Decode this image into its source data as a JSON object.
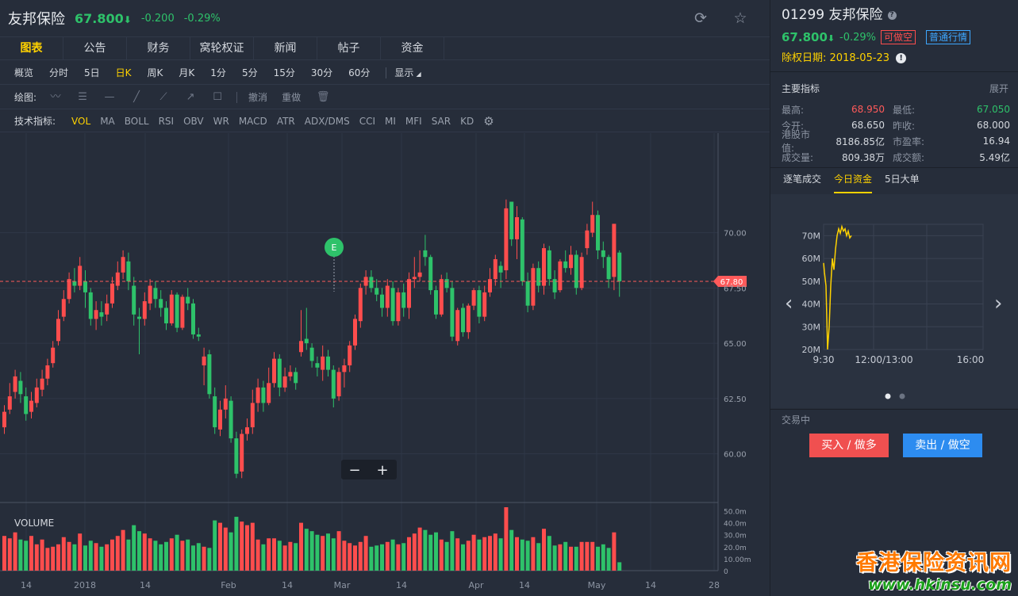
{
  "header": {
    "name": "友邦保险",
    "price": "67.800",
    "arrow": "⬇",
    "change": "-0.200",
    "change_pct": "-0.29%"
  },
  "tabs": [
    "图表",
    "公告",
    "财务",
    "窝轮权证",
    "新闻",
    "帖子",
    "资金"
  ],
  "periods": [
    "概览",
    "分时",
    "5日",
    "日K",
    "周K",
    "月K",
    "1分",
    "5分",
    "15分",
    "30分",
    "60分"
  ],
  "display_label": "显示",
  "draw_label": "绘图:",
  "draw_undo": "撤消",
  "draw_redo": "重做",
  "ind_label": "技术指标:",
  "indicators": [
    "VOL",
    "MA",
    "BOLL",
    "RSI",
    "OBV",
    "WR",
    "MACD",
    "ATR",
    "ADX/DMS",
    "CCI",
    "MI",
    "MFI",
    "SAR",
    "KD"
  ],
  "chart": {
    "current_price_tag": "67.80",
    "event_marker": "E",
    "volume_label": "VOLUME",
    "zoom_minus": "−",
    "zoom_plus": "+"
  },
  "chart_data": {
    "type": "candlestick",
    "price_axis_ticks": [
      "70.00",
      "67.50",
      "65.00",
      "62.50",
      "60.00"
    ],
    "price_axis_values": [
      70.0,
      67.5,
      65.0,
      62.5,
      60.0
    ],
    "ylim": [
      57.8,
      74.5
    ],
    "volume_axis_ticks": [
      "50.0m",
      "40.0m",
      "30.0m",
      "20.0m",
      "10.00m",
      "0"
    ],
    "volume_axis_values": [
      50,
      40,
      30,
      20,
      10,
      0
    ],
    "vol_max": 53,
    "x_labels": [
      "14",
      "2018",
      "14",
      "Feb",
      "14",
      "Mar",
      "14",
      "Apr",
      "14",
      "May",
      "14",
      "28"
    ],
    "current_price": 67.8,
    "candles": [
      {
        "o": 61.2,
        "c": 61.9,
        "h": 62.2,
        "l": 60.9,
        "v": 29
      },
      {
        "o": 62.0,
        "c": 62.6,
        "h": 63.2,
        "l": 61.8,
        "v": 27
      },
      {
        "o": 62.8,
        "c": 63.5,
        "h": 63.8,
        "l": 62.5,
        "v": 32
      },
      {
        "o": 63.3,
        "c": 62.7,
        "h": 63.7,
        "l": 62.3,
        "v": 26
      },
      {
        "o": 62.6,
        "c": 61.8,
        "h": 63.0,
        "l": 61.5,
        "v": 25
      },
      {
        "o": 61.9,
        "c": 62.4,
        "h": 62.8,
        "l": 61.6,
        "v": 29
      },
      {
        "o": 62.3,
        "c": 63.0,
        "h": 63.4,
        "l": 62.1,
        "v": 22
      },
      {
        "o": 62.9,
        "c": 63.4,
        "h": 63.8,
        "l": 62.6,
        "v": 26
      },
      {
        "o": 63.4,
        "c": 64.0,
        "h": 64.3,
        "l": 63.1,
        "v": 19
      },
      {
        "o": 64.1,
        "c": 64.8,
        "h": 65.1,
        "l": 63.9,
        "v": 20
      },
      {
        "o": 65.1,
        "c": 66.1,
        "h": 66.5,
        "l": 64.9,
        "v": 22
      },
      {
        "o": 66.2,
        "c": 67.0,
        "h": 67.4,
        "l": 66.0,
        "v": 28
      },
      {
        "o": 67.0,
        "c": 67.9,
        "h": 68.2,
        "l": 66.8,
        "v": 24
      },
      {
        "o": 67.8,
        "c": 67.6,
        "h": 68.4,
        "l": 67.3,
        "v": 22
      },
      {
        "o": 67.6,
        "c": 68.5,
        "h": 68.9,
        "l": 67.4,
        "v": 31
      },
      {
        "o": 67.8,
        "c": 67.3,
        "h": 68.3,
        "l": 66.6,
        "v": 21
      },
      {
        "o": 67.3,
        "c": 66.1,
        "h": 67.5,
        "l": 65.8,
        "v": 25
      },
      {
        "o": 66.1,
        "c": 66.5,
        "h": 66.9,
        "l": 65.6,
        "v": 23
      },
      {
        "o": 66.4,
        "c": 66.2,
        "h": 66.9,
        "l": 65.8,
        "v": 20
      },
      {
        "o": 66.3,
        "c": 66.8,
        "h": 67.2,
        "l": 66.0,
        "v": 22
      },
      {
        "o": 66.8,
        "c": 67.7,
        "h": 68.0,
        "l": 66.6,
        "v": 26
      },
      {
        "o": 67.6,
        "c": 68.2,
        "h": 68.7,
        "l": 67.4,
        "v": 29
      },
      {
        "o": 68.2,
        "c": 68.9,
        "h": 69.2,
        "l": 67.9,
        "v": 34
      },
      {
        "o": 68.7,
        "c": 67.8,
        "h": 69.1,
        "l": 67.4,
        "v": 26
      },
      {
        "o": 67.6,
        "c": 66.3,
        "h": 68.0,
        "l": 65.8,
        "v": 38
      },
      {
        "o": 66.2,
        "c": 66.1,
        "h": 66.6,
        "l": 64.5,
        "v": 33
      },
      {
        "o": 66.1,
        "c": 66.9,
        "h": 67.3,
        "l": 65.8,
        "v": 31
      },
      {
        "o": 66.8,
        "c": 67.6,
        "h": 67.9,
        "l": 66.5,
        "v": 27
      },
      {
        "o": 67.5,
        "c": 67.0,
        "h": 67.8,
        "l": 66.6,
        "v": 25
      },
      {
        "o": 67.0,
        "c": 66.6,
        "h": 67.4,
        "l": 66.2,
        "v": 22
      },
      {
        "o": 66.6,
        "c": 65.9,
        "h": 66.9,
        "l": 65.6,
        "v": 24
      },
      {
        "o": 65.9,
        "c": 67.2,
        "h": 67.4,
        "l": 65.8,
        "v": 27
      },
      {
        "o": 67.2,
        "c": 65.7,
        "h": 67.3,
        "l": 65.5,
        "v": 30
      },
      {
        "o": 65.7,
        "c": 67.1,
        "h": 67.2,
        "l": 65.6,
        "v": 25
      },
      {
        "o": 67.1,
        "c": 66.8,
        "h": 67.5,
        "l": 66.5,
        "v": 26
      },
      {
        "o": 66.8,
        "c": 65.4,
        "h": 67.0,
        "l": 65.2,
        "v": 21
      },
      {
        "o": 65.4,
        "c": 65.3,
        "h": 65.7,
        "l": 65.1,
        "v": 23
      },
      {
        "o": 64.0,
        "c": 64.4,
        "h": 64.8,
        "l": 63.1,
        "v": 20
      },
      {
        "o": 64.5,
        "c": 62.7,
        "h": 64.7,
        "l": 62.5,
        "v": 19
      },
      {
        "o": 62.6,
        "c": 61.2,
        "h": 63.0,
        "l": 60.9,
        "v": 42
      },
      {
        "o": 61.1,
        "c": 62.0,
        "h": 62.4,
        "l": 60.8,
        "v": 40
      },
      {
        "o": 62.0,
        "c": 62.5,
        "h": 63.1,
        "l": 61.6,
        "v": 36
      },
      {
        "o": 62.4,
        "c": 60.7,
        "h": 62.6,
        "l": 60.5,
        "v": 32
      },
      {
        "o": 60.7,
        "c": 59.1,
        "h": 61.0,
        "l": 58.9,
        "v": 45
      },
      {
        "o": 59.2,
        "c": 60.9,
        "h": 61.1,
        "l": 58.9,
        "v": 41
      },
      {
        "o": 60.9,
        "c": 61.2,
        "h": 61.6,
        "l": 60.6,
        "v": 38
      },
      {
        "o": 61.2,
        "c": 62.3,
        "h": 62.9,
        "l": 60.9,
        "v": 40
      },
      {
        "o": 62.3,
        "c": 63.0,
        "h": 63.4,
        "l": 61.9,
        "v": 26
      },
      {
        "o": 63.0,
        "c": 62.3,
        "h": 63.3,
        "l": 61.9,
        "v": 22
      },
      {
        "o": 62.3,
        "c": 63.2,
        "h": 63.9,
        "l": 62.2,
        "v": 27
      },
      {
        "o": 63.2,
        "c": 64.3,
        "h": 64.6,
        "l": 63.0,
        "v": 27
      },
      {
        "o": 64.3,
        "c": 63.0,
        "h": 64.5,
        "l": 62.6,
        "v": 25
      },
      {
        "o": 63.0,
        "c": 63.5,
        "h": 63.9,
        "l": 62.8,
        "v": 21
      },
      {
        "o": 63.5,
        "c": 63.7,
        "h": 64.0,
        "l": 63.3,
        "v": 24
      },
      {
        "o": 63.7,
        "c": 63.2,
        "h": 63.9,
        "l": 62.9,
        "v": 23
      },
      {
        "o": 64.6,
        "c": 65.1,
        "h": 66.5,
        "l": 64.4,
        "v": 40
      },
      {
        "o": 65.2,
        "c": 65.0,
        "h": 66.6,
        "l": 64.7,
        "v": 35
      },
      {
        "o": 64.8,
        "c": 64.2,
        "h": 65.0,
        "l": 63.9,
        "v": 33
      },
      {
        "o": 64.1,
        "c": 63.9,
        "h": 64.4,
        "l": 63.5,
        "v": 30
      },
      {
        "o": 63.8,
        "c": 64.4,
        "h": 64.9,
        "l": 63.3,
        "v": 29
      },
      {
        "o": 64.4,
        "c": 63.8,
        "h": 64.7,
        "l": 63.5,
        "v": 31
      },
      {
        "o": 63.8,
        "c": 62.5,
        "h": 64.0,
        "l": 62.1,
        "v": 27
      },
      {
        "o": 62.6,
        "c": 63.7,
        "h": 63.9,
        "l": 62.4,
        "v": 33
      },
      {
        "o": 63.7,
        "c": 64.0,
        "h": 64.3,
        "l": 63.0,
        "v": 25
      },
      {
        "o": 64.0,
        "c": 64.9,
        "h": 65.1,
        "l": 63.7,
        "v": 23
      },
      {
        "o": 64.9,
        "c": 66.1,
        "h": 66.3,
        "l": 64.7,
        "v": 21
      },
      {
        "o": 66.0,
        "c": 67.5,
        "h": 67.7,
        "l": 65.7,
        "v": 24
      },
      {
        "o": 67.6,
        "c": 68.0,
        "h": 68.3,
        "l": 67.2,
        "v": 29
      },
      {
        "o": 68.0,
        "c": 67.5,
        "h": 68.3,
        "l": 67.3,
        "v": 20
      },
      {
        "o": 67.5,
        "c": 67.2,
        "h": 67.9,
        "l": 66.9,
        "v": 21
      },
      {
        "o": 67.2,
        "c": 66.6,
        "h": 67.5,
        "l": 66.2,
        "v": 22
      },
      {
        "o": 66.6,
        "c": 67.6,
        "h": 67.9,
        "l": 66.2,
        "v": 24
      },
      {
        "o": 67.5,
        "c": 66.0,
        "h": 67.8,
        "l": 65.8,
        "v": 26
      },
      {
        "o": 66.0,
        "c": 67.3,
        "h": 67.5,
        "l": 65.8,
        "v": 22
      },
      {
        "o": 67.3,
        "c": 66.6,
        "h": 67.7,
        "l": 66.2,
        "v": 23
      },
      {
        "o": 66.6,
        "c": 67.9,
        "h": 68.2,
        "l": 66.1,
        "v": 28
      },
      {
        "o": 67.9,
        "c": 68.0,
        "h": 68.9,
        "l": 67.5,
        "v": 31
      },
      {
        "o": 68.0,
        "c": 68.2,
        "h": 69.2,
        "l": 67.8,
        "v": 36
      },
      {
        "o": 69.2,
        "c": 68.9,
        "h": 69.9,
        "l": 68.5,
        "v": 34
      },
      {
        "o": 68.9,
        "c": 67.4,
        "h": 69.0,
        "l": 67.2,
        "v": 30
      },
      {
        "o": 67.4,
        "c": 66.3,
        "h": 67.6,
        "l": 66.1,
        "v": 32
      },
      {
        "o": 66.3,
        "c": 67.9,
        "h": 68.1,
        "l": 66.2,
        "v": 26
      },
      {
        "o": 67.9,
        "c": 67.5,
        "h": 68.2,
        "l": 67.3,
        "v": 24
      },
      {
        "o": 67.5,
        "c": 65.3,
        "h": 67.8,
        "l": 65.1,
        "v": 33
      },
      {
        "o": 65.1,
        "c": 66.5,
        "h": 66.6,
        "l": 64.9,
        "v": 27
      },
      {
        "o": 66.6,
        "c": 65.5,
        "h": 66.8,
        "l": 65.3,
        "v": 22
      },
      {
        "o": 65.5,
        "c": 66.7,
        "h": 66.8,
        "l": 65.2,
        "v": 25
      },
      {
        "o": 66.7,
        "c": 67.4,
        "h": 67.5,
        "l": 66.5,
        "v": 30
      },
      {
        "o": 67.4,
        "c": 66.2,
        "h": 67.6,
        "l": 65.9,
        "v": 26
      },
      {
        "o": 66.2,
        "c": 67.3,
        "h": 67.6,
        "l": 66.0,
        "v": 28
      },
      {
        "o": 67.3,
        "c": 67.9,
        "h": 68.4,
        "l": 67.1,
        "v": 29
      },
      {
        "o": 67.9,
        "c": 68.8,
        "h": 69.0,
        "l": 67.6,
        "v": 31
      },
      {
        "o": 68.5,
        "c": 68.2,
        "h": 68.7,
        "l": 67.5,
        "v": 27
      },
      {
        "o": 68.3,
        "c": 71.1,
        "h": 71.5,
        "l": 67.9,
        "v": 53
      },
      {
        "o": 71.4,
        "c": 69.7,
        "h": 71.4,
        "l": 69.4,
        "v": 34
      },
      {
        "o": 69.7,
        "c": 70.7,
        "h": 71.2,
        "l": 68.8,
        "v": 28
      },
      {
        "o": 70.6,
        "c": 67.8,
        "h": 70.7,
        "l": 67.6,
        "v": 26
      },
      {
        "o": 67.8,
        "c": 66.7,
        "h": 68.2,
        "l": 66.4,
        "v": 25
      },
      {
        "o": 66.7,
        "c": 68.4,
        "h": 68.6,
        "l": 66.5,
        "v": 28
      },
      {
        "o": 68.4,
        "c": 67.6,
        "h": 68.7,
        "l": 67.3,
        "v": 23
      },
      {
        "o": 67.6,
        "c": 69.3,
        "h": 69.5,
        "l": 67.2,
        "v": 35
      },
      {
        "o": 69.2,
        "c": 67.9,
        "h": 69.4,
        "l": 67.6,
        "v": 29
      },
      {
        "o": 67.9,
        "c": 67.3,
        "h": 68.3,
        "l": 67.0,
        "v": 21
      },
      {
        "o": 67.4,
        "c": 68.7,
        "h": 68.8,
        "l": 67.3,
        "v": 22
      },
      {
        "o": 68.7,
        "c": 68.4,
        "h": 69.2,
        "l": 68.2,
        "v": 24
      },
      {
        "o": 68.4,
        "c": 69.0,
        "h": 69.4,
        "l": 68.1,
        "v": 20
      },
      {
        "o": 69.0,
        "c": 67.5,
        "h": 69.2,
        "l": 67.2,
        "v": 20
      },
      {
        "o": 67.5,
        "c": 68.9,
        "h": 69.1,
        "l": 67.4,
        "v": 24
      },
      {
        "o": 69.3,
        "c": 70.1,
        "h": 70.4,
        "l": 69.0,
        "v": 24
      },
      {
        "o": 70.0,
        "c": 70.8,
        "h": 71.4,
        "l": 69.8,
        "v": 24
      },
      {
        "o": 70.8,
        "c": 69.2,
        "h": 71.0,
        "l": 68.8,
        "v": 20
      },
      {
        "o": 69.2,
        "c": 68.9,
        "h": 69.6,
        "l": 68.4,
        "v": 22
      },
      {
        "o": 68.9,
        "c": 67.9,
        "h": 69.0,
        "l": 67.5,
        "v": 19
      },
      {
        "o": 68.0,
        "c": 70.4,
        "h": 70.4,
        "l": 67.4,
        "v": 32
      },
      {
        "o": 69.1,
        "c": 67.8,
        "h": 69.2,
        "l": 67.1,
        "v": 7
      }
    ]
  },
  "right": {
    "code": "01299",
    "name": "友邦保险",
    "help": "?",
    "price": "67.800",
    "arrow": "⬇",
    "change_pct": "-0.29%",
    "tag_short": "可做空",
    "tag_normal": "普通行情",
    "ex_label": "除权日期:",
    "ex_date": "2018-05-23",
    "ex_icon": "!",
    "key_title": "主要指标",
    "key_expand": "展开",
    "key_rows": [
      {
        "l1": "最高:",
        "v1": "68.950",
        "c1": "up",
        "l2": "最低:",
        "v2": "67.050",
        "c2": "dn"
      },
      {
        "l1": "今开:",
        "v1": "68.650",
        "c1": "",
        "l2": "昨收:",
        "v2": "68.000",
        "c2": ""
      },
      {
        "l1": "港股市值:",
        "v1": "8186.85亿",
        "c1": "",
        "l2": "市盈率:",
        "v2": "16.94",
        "c2": ""
      },
      {
        "l1": "成交量:",
        "v1": "809.38万",
        "c1": "",
        "l2": "成交额:",
        "v2": "5.49亿",
        "c2": ""
      }
    ],
    "tabs": [
      "逐笔成交",
      "今日资金",
      "5日大单"
    ],
    "mini_y": [
      "70M",
      "60M",
      "50M",
      "40M",
      "30M",
      "20M"
    ],
    "mini_y_values": [
      70,
      60,
      50,
      40,
      30,
      20
    ],
    "mini_x": [
      "9:30",
      "12:00/13:00",
      "16:00"
    ],
    "mini_prev": "‹",
    "mini_next": "›",
    "status": "交易中",
    "buy": "买入 / 做多",
    "sell": "卖出 / 做空"
  },
  "watermark": {
    "cn": "香港保险资讯网",
    "url": "www.hkinsu.com"
  },
  "colors": {
    "up": "#ff4d4d",
    "down": "#2ec26a",
    "accent": "#ffd200",
    "bg": "#262d3a"
  }
}
